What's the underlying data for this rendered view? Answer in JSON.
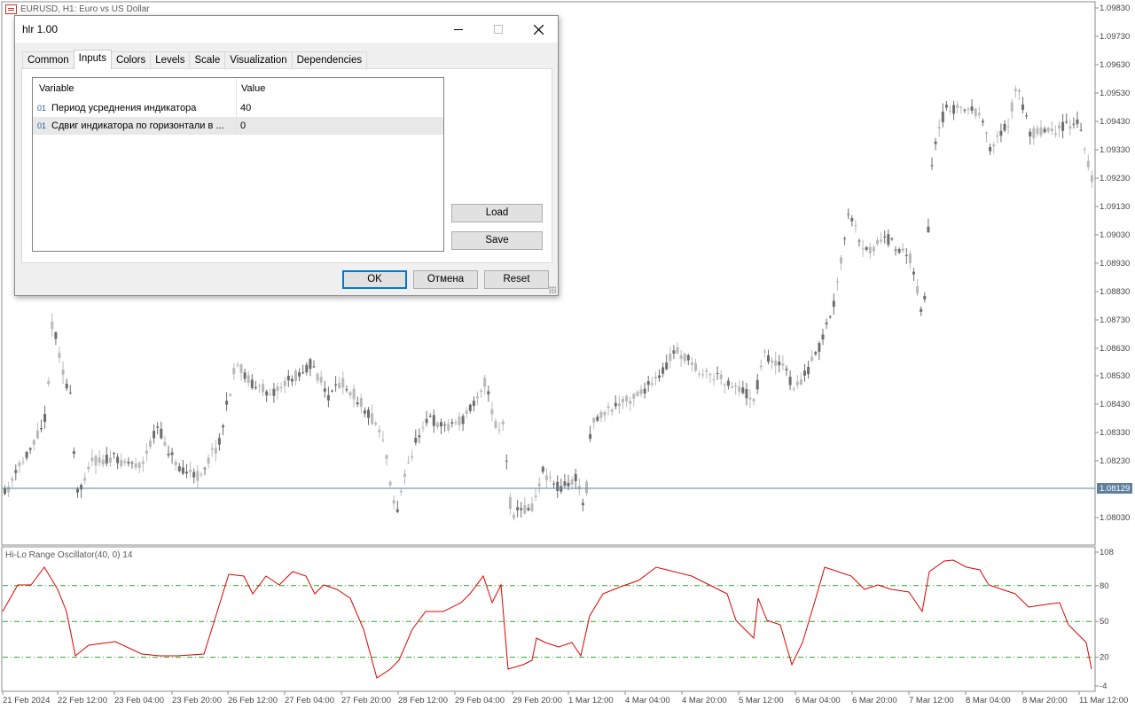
{
  "window": {
    "title": "EURUSD, H1:  Euro vs US Dollar"
  },
  "price_axis": {
    "labels": [
      "1.09830",
      "1.09730",
      "1.09630",
      "1.09530",
      "1.09430",
      "1.09330",
      "1.09230",
      "1.09130",
      "1.09030",
      "1.08930",
      "1.08830",
      "1.08730",
      "1.08630",
      "1.08530",
      "1.08430",
      "1.08330",
      "1.08230",
      "1.08030"
    ],
    "current_price": "1.08129"
  },
  "time_axis": {
    "labels": [
      "21 Feb 2024",
      "22 Feb 12:00",
      "23 Feb 04:00",
      "23 Feb 20:00",
      "26 Feb 12:00",
      "27 Feb 04:00",
      "27 Feb 20:00",
      "28 Feb 12:00",
      "29 Feb 04:00",
      "29 Feb 20:00",
      "1 Mar 12:00",
      "4 Mar 04:00",
      "4 Mar 20:00",
      "5 Mar 12:00",
      "6 Mar 04:00",
      "6 Mar 20:00",
      "7 Mar 12:00",
      "8 Mar 04:00",
      "8 Mar 20:00",
      "11 Mar 12:00"
    ]
  },
  "oscillator": {
    "title": "Hi-Lo Range Oscillator(40, 0) 14",
    "axis_labels": [
      "108",
      "80",
      "50",
      "20",
      "-4"
    ],
    "level_color": "#2ea62e",
    "line_color": "#e00000"
  },
  "dialog": {
    "title": "hlr 1.00",
    "tabs": [
      "Common",
      "Inputs",
      "Colors",
      "Levels",
      "Scale",
      "Visualization",
      "Dependencies"
    ],
    "active_tab": "Inputs",
    "grid": {
      "headers": {
        "variable": "Variable",
        "value": "Value"
      },
      "rows": [
        {
          "icon": "01",
          "variable": "Период усреднения индикатора",
          "value": "40"
        },
        {
          "icon": "01",
          "variable": "Сдвиг индикатора по горизонтали в ...",
          "value": "0"
        }
      ]
    },
    "buttons": {
      "load": "Load",
      "save": "Save",
      "ok": "OK",
      "cancel": "Отмена",
      "reset": "Reset"
    }
  }
}
